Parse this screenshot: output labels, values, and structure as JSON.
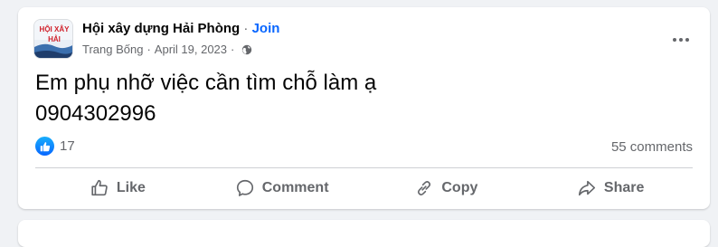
{
  "post": {
    "group_name": "Hội xây dựng Hải Phòng",
    "separator": " · ",
    "join_label": "Join",
    "author": "Trang Bống",
    "meta_separator": "·",
    "date": "April 19, 2023",
    "privacy_icon": "globe-icon",
    "more_icon": "more-options-icon",
    "text_line1": "Em phụ nhỡ việc cần tìm chỗ làm ạ",
    "text_line2": "0904302996"
  },
  "avatar": {
    "logo_text_1": "HỘI XÂY",
    "logo_text_2": "HẢI"
  },
  "reactions": {
    "icon": "like-reaction-icon",
    "count": "17",
    "comments": "55 comments"
  },
  "actions": [
    {
      "label": "Like",
      "icon": "thumbs-up-icon"
    },
    {
      "label": "Comment",
      "icon": "comment-icon"
    },
    {
      "label": "Copy",
      "icon": "link-icon"
    },
    {
      "label": "Share",
      "icon": "share-icon"
    }
  ],
  "colors": {
    "link_blue": "#0866ff",
    "secondary_text": "#65676b",
    "background": "#f0f2f5"
  }
}
